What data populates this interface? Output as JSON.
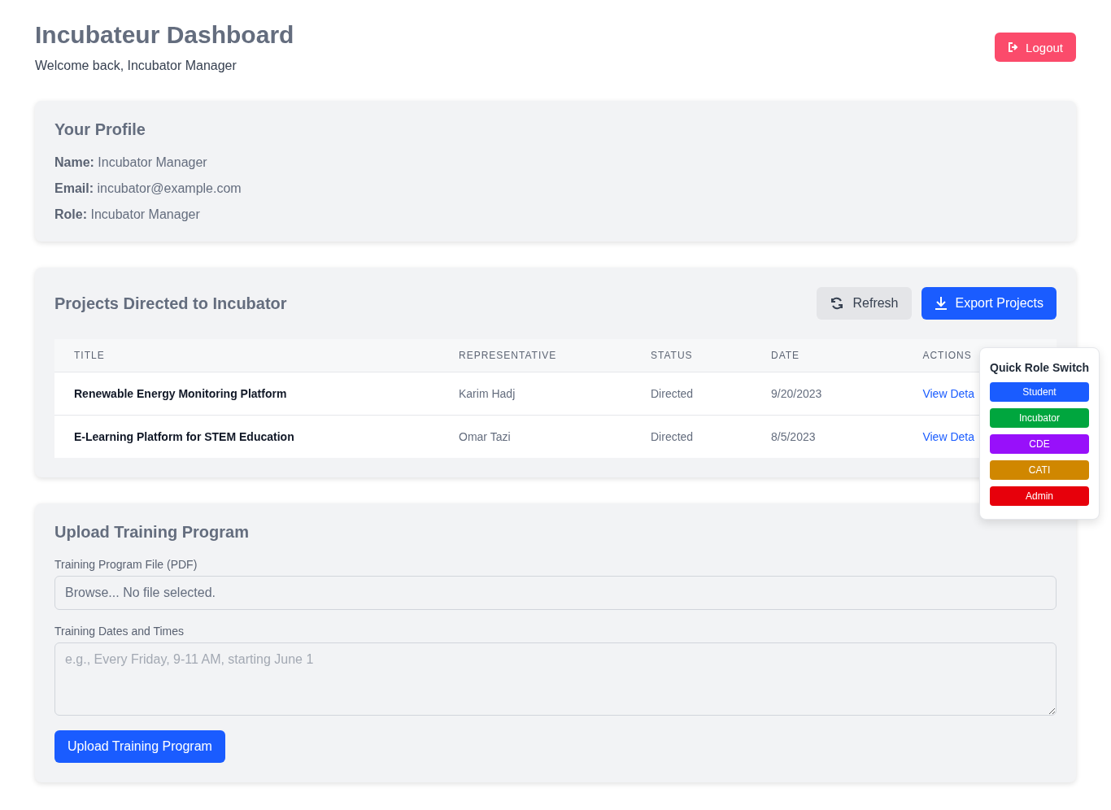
{
  "header": {
    "title": "Incubateur Dashboard",
    "subtitle": "Welcome back, Incubator Manager",
    "logout": "Logout"
  },
  "profile": {
    "title": "Your Profile",
    "fields": [
      {
        "label": "Name:",
        "value": "Incubator Manager"
      },
      {
        "label": "Email:",
        "value": "incubator@example.com"
      },
      {
        "label": "Role:",
        "value": "Incubator Manager"
      }
    ]
  },
  "projects": {
    "title": "Projects Directed to Incubator",
    "refresh": "Refresh",
    "export": "Export Projects",
    "table": {
      "columns": [
        "TITLE",
        "REPRESENTATIVE",
        "STATUS",
        "DATE",
        "ACTIONS"
      ],
      "rows": [
        {
          "title": "Renewable Energy Monitoring Platform",
          "representative": "Karim Hadj",
          "status": "Directed",
          "date": "9/20/2023",
          "action": "View Deta"
        },
        {
          "title": "E-Learning Platform for STEM Education",
          "representative": "Omar Tazi",
          "status": "Directed",
          "date": "8/5/2023",
          "action": "View Deta"
        }
      ]
    }
  },
  "upload": {
    "title": "Upload Training Program",
    "file_label": "Training Program File (PDF)",
    "file_value": "Browse... No file selected.",
    "dates_label": "Training Dates and Times",
    "dates_placeholder": "e.g., Every Friday, 9-11 AM, starting June 1",
    "submit": "Upload Training Program"
  },
  "role_switch": {
    "title": "Quick Role Switch",
    "roles": [
      {
        "label": "Student",
        "color": "#1a5cff"
      },
      {
        "label": "Incubator",
        "color": "#00a63e"
      },
      {
        "label": "CDE",
        "color": "#9810fa"
      },
      {
        "label": "CATI",
        "color": "#d08700"
      },
      {
        "label": "Admin",
        "color": "#e7000b"
      }
    ]
  }
}
